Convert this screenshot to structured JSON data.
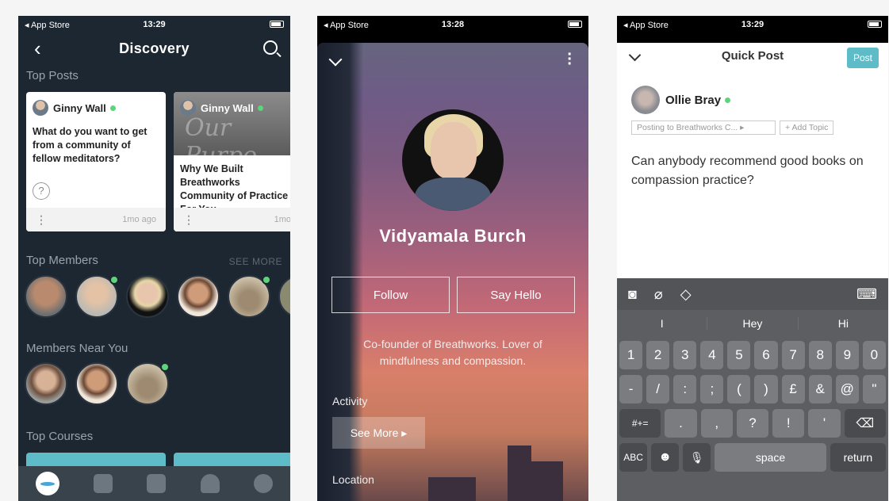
{
  "screen1": {
    "status": {
      "carrier": "◂ App Store",
      "time": "13:29"
    },
    "nav": {
      "title": "Discovery"
    },
    "sections": {
      "top_posts": "Top Posts",
      "top_members": "Top Members",
      "see_more": "SEE MORE",
      "members_near_you": "Members Near You",
      "top_courses": "Top Courses"
    },
    "posts": [
      {
        "author": "Ginny Wall",
        "text": "What do you want to get from a community of fellow meditators?",
        "time": "1mo ago"
      },
      {
        "author": "Ginny Wall",
        "image_text": "Our Purpo",
        "text": "Why We Built Breathworks Community of Practice For You",
        "time": "1mo"
      }
    ]
  },
  "screen2": {
    "status": {
      "carrier": "◂ App Store",
      "time": "13:28"
    },
    "name": "Vidyamala Burch",
    "follow_label": "Follow",
    "say_hello_label": "Say Hello",
    "bio": "Co-founder of Breathworks. Lover of mindfulness and compassion.",
    "activity_label": "Activity",
    "see_more_label": "See More ▸",
    "location_label": "Location"
  },
  "screen3": {
    "status": {
      "carrier": "◂ App Store",
      "time": "13:29"
    },
    "title": "Quick Post",
    "post_button": "Post",
    "author": "Ollie Bray",
    "posting_to": "Posting to Breathworks C... ▸",
    "add_topic": "+ Add Topic",
    "text": "Can anybody recommend good books on compassion practice?",
    "suggestions": [
      "I",
      "Hey",
      "Hi"
    ],
    "keys_row1": [
      "1",
      "2",
      "3",
      "4",
      "5",
      "6",
      "7",
      "8",
      "9",
      "0"
    ],
    "keys_row2": [
      "-",
      "/",
      ":",
      ";",
      "(",
      ")",
      "£",
      "&",
      "@",
      "\""
    ],
    "keys_row3": [
      "#+=",
      ".",
      ",",
      "?",
      "!",
      "'",
      "⌫"
    ],
    "keys_row4": [
      "ABC",
      "☻",
      "🎙",
      "space",
      "return"
    ]
  }
}
